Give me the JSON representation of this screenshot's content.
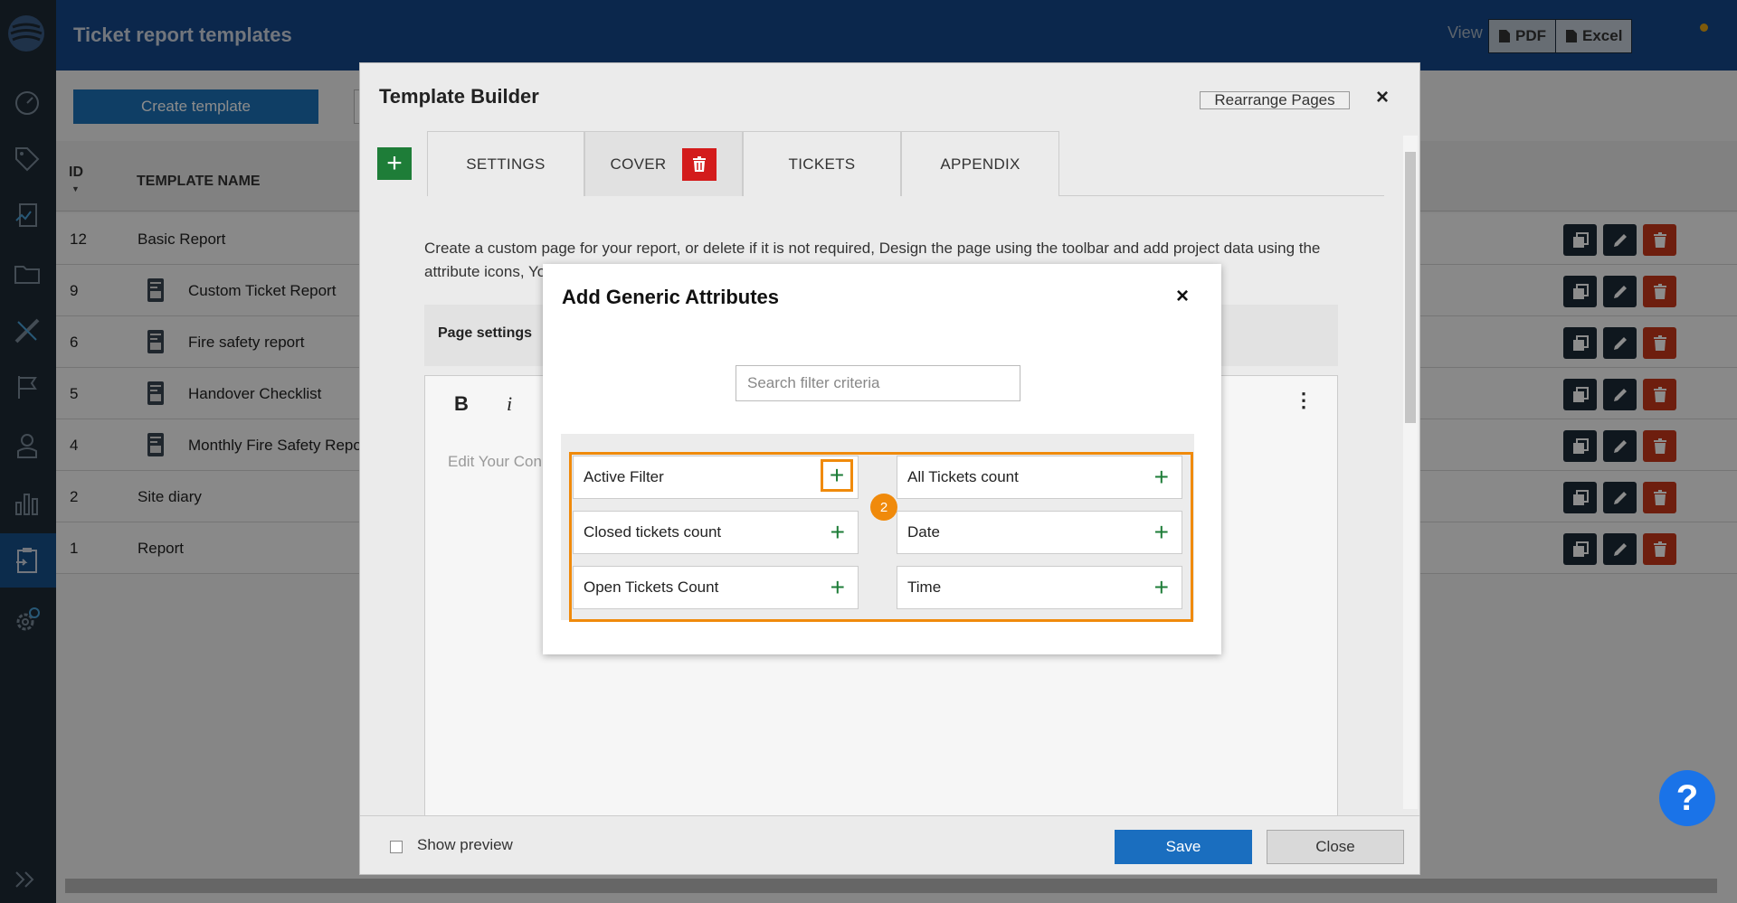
{
  "header": {
    "title": "Ticket report templates",
    "view_label": "View",
    "pdf_label": "PDF",
    "excel_label": "Excel"
  },
  "toolbar": {
    "create_label": "Create template"
  },
  "table": {
    "col_id": "ID",
    "col_name": "TEMPLATE NAME",
    "rows": [
      {
        "id": "12",
        "name": "Basic Report",
        "has_icon": false
      },
      {
        "id": "9",
        "name": "Custom Ticket Report",
        "has_icon": true
      },
      {
        "id": "6",
        "name": "Fire safety report",
        "has_icon": true
      },
      {
        "id": "5",
        "name": "Handover Checklist",
        "has_icon": true
      },
      {
        "id": "4",
        "name": "Monthly Fire Safety Repo",
        "has_icon": true
      },
      {
        "id": "2",
        "name": "Site diary",
        "has_icon": false
      },
      {
        "id": "1",
        "name": "Report",
        "has_icon": false
      }
    ]
  },
  "builder": {
    "title": "Template Builder",
    "rearrange_label": "Rearrange Pages",
    "close_icon": "×",
    "add_icon": "+",
    "tabs": [
      {
        "label": "SETTINGS"
      },
      {
        "label": "COVER"
      },
      {
        "label": "TICKETS"
      },
      {
        "label": "APPENDIX"
      }
    ],
    "description": "Create a custom page for your report, or delete if it is not required, Design the page using the toolbar and add project data using the attribute icons, Yo",
    "page_settings_label": "Page settings",
    "editor": {
      "bold_label": "B",
      "italic_label": "i",
      "more_icon": "⋮",
      "placeholder": "Edit Your Con"
    },
    "show_preview_label": "Show preview",
    "save_label": "Save",
    "close_label": "Close"
  },
  "generic_attributes": {
    "title": "Add Generic Attributes",
    "close_icon": "×",
    "search_placeholder": "Search filter criteria",
    "left_items": [
      {
        "label": "Active Filter"
      },
      {
        "label": "Closed tickets count"
      },
      {
        "label": "Open Tickets Count"
      }
    ],
    "right_items": [
      {
        "label": "All Tickets count"
      },
      {
        "label": "Date"
      },
      {
        "label": "Time"
      }
    ],
    "plus_icon": "+",
    "step_badge": "2"
  },
  "help_label": "?",
  "colors": {
    "header_bg": "#14488a",
    "sidebar_bg": "#1e2a36",
    "accent_orange": "#f08a0b",
    "green": "#1e7d38",
    "save_blue": "#1a6ebf",
    "delete_red": "#c8371a"
  },
  "icons": {
    "sidebar": [
      "logo-icon",
      "dashboard-icon",
      "tag-icon",
      "report-icon",
      "folder-icon",
      "ruler-icon",
      "flag-icon",
      "user-icon",
      "chart-icon",
      "clipboard-icon",
      "settings-icon",
      "expand-icon"
    ]
  }
}
